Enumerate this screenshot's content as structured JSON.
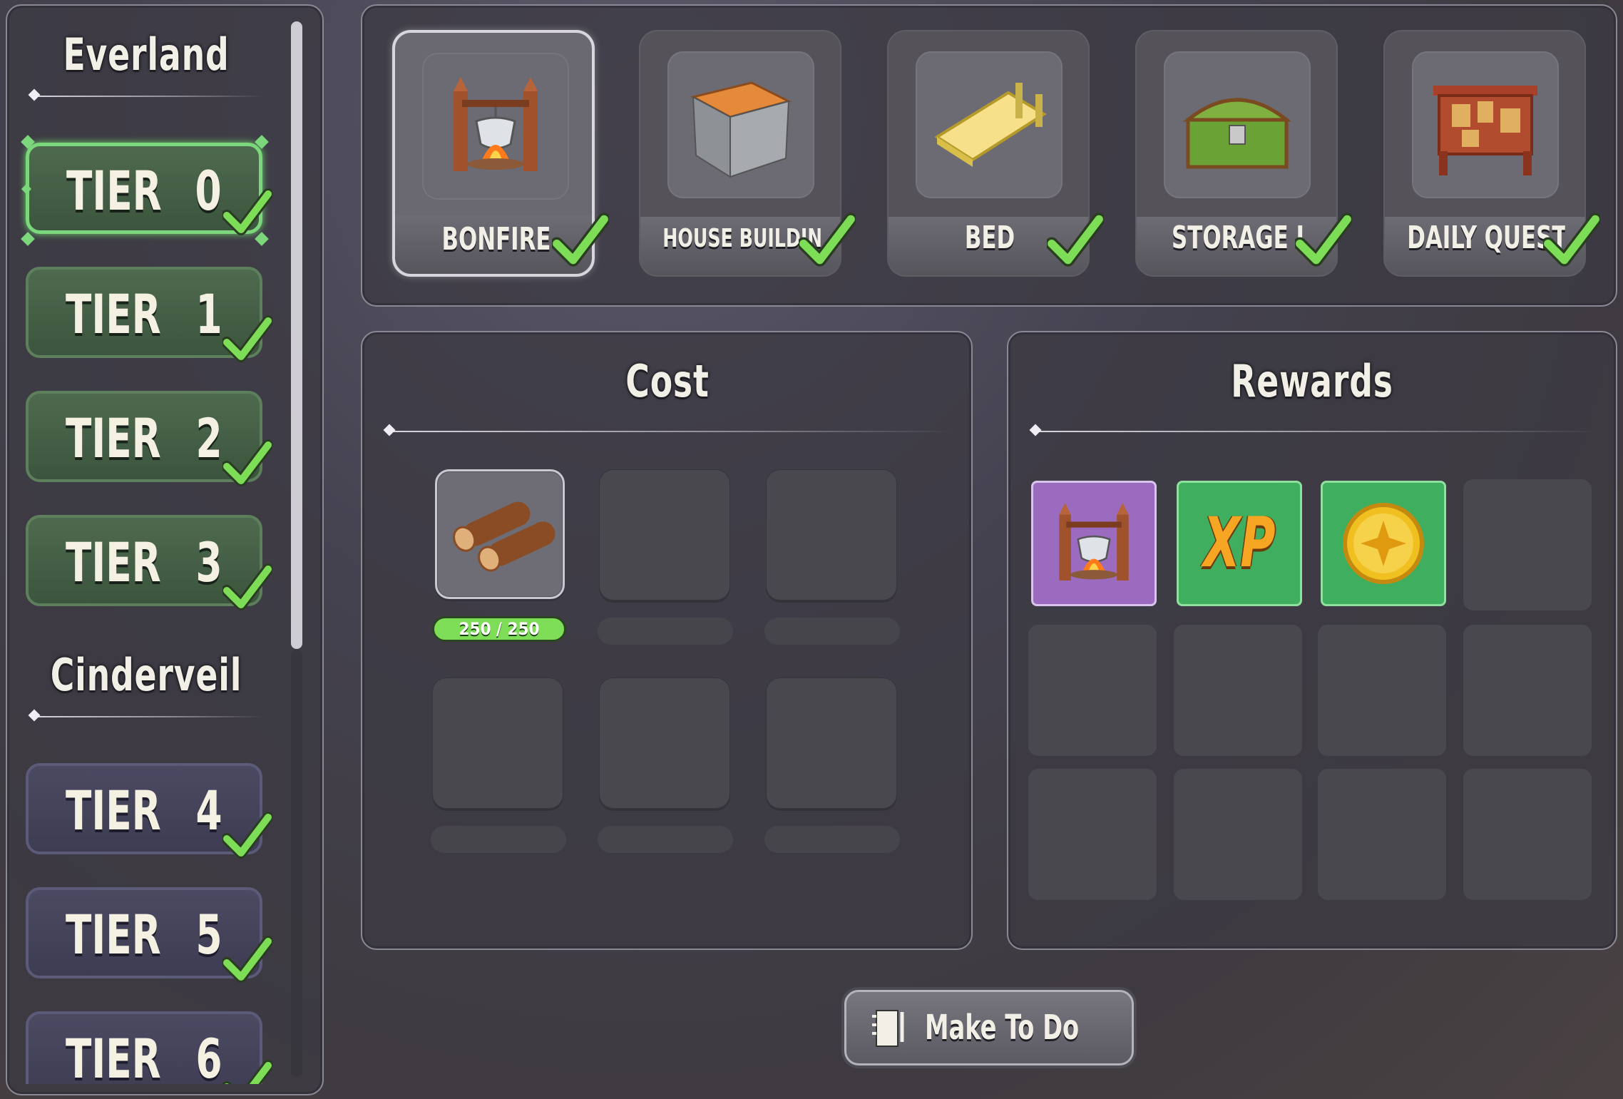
{
  "sidebar": {
    "regions": [
      {
        "name": "Everland"
      },
      {
        "name": "Cinderveil"
      }
    ],
    "tier_word": "TIER",
    "tiers": [
      {
        "number": "0",
        "completed": true,
        "selected": true,
        "region": "Everland"
      },
      {
        "number": "1",
        "completed": true,
        "selected": false,
        "region": "Everland"
      },
      {
        "number": "2",
        "completed": true,
        "selected": false,
        "region": "Everland"
      },
      {
        "number": "3",
        "completed": true,
        "selected": false,
        "region": "Everland"
      },
      {
        "number": "4",
        "completed": true,
        "selected": false,
        "region": "Cinderveil"
      },
      {
        "number": "5",
        "completed": true,
        "selected": false,
        "region": "Cinderveil"
      },
      {
        "number": "6",
        "completed": true,
        "selected": false,
        "region": "Cinderveil"
      }
    ]
  },
  "quests": [
    {
      "label": "BONFIRE",
      "icon": "bonfire-icon",
      "completed": true,
      "selected": true
    },
    {
      "label": "HOUSE BUILDING I",
      "icon": "stone-block-icon",
      "completed": true,
      "selected": false
    },
    {
      "label": "BED",
      "icon": "bed-icon",
      "completed": true,
      "selected": false
    },
    {
      "label": "STORAGE I",
      "icon": "chest-icon",
      "completed": true,
      "selected": false
    },
    {
      "label": "DAILY QUESTS",
      "icon": "quest-board-icon",
      "completed": true,
      "selected": false
    }
  ],
  "cost": {
    "title": "Cost",
    "items": [
      {
        "icon": "logs-icon",
        "progress_text": "250 / 250",
        "current": 250,
        "required": 250
      }
    ]
  },
  "rewards": {
    "title": "Rewards",
    "items": [
      {
        "icon": "bonfire-icon",
        "rarity_color": "#9b6bc0"
      },
      {
        "icon": "xp-icon",
        "label": "XP",
        "rarity_color": "#3fae5e"
      },
      {
        "icon": "coin-icon",
        "rarity_color": "#3fae5e"
      }
    ]
  },
  "action_button": {
    "label": "Make To Do",
    "icon": "notebook-icon"
  },
  "colors": {
    "check": "#7ddd56",
    "active_border": "#7cd67b"
  }
}
